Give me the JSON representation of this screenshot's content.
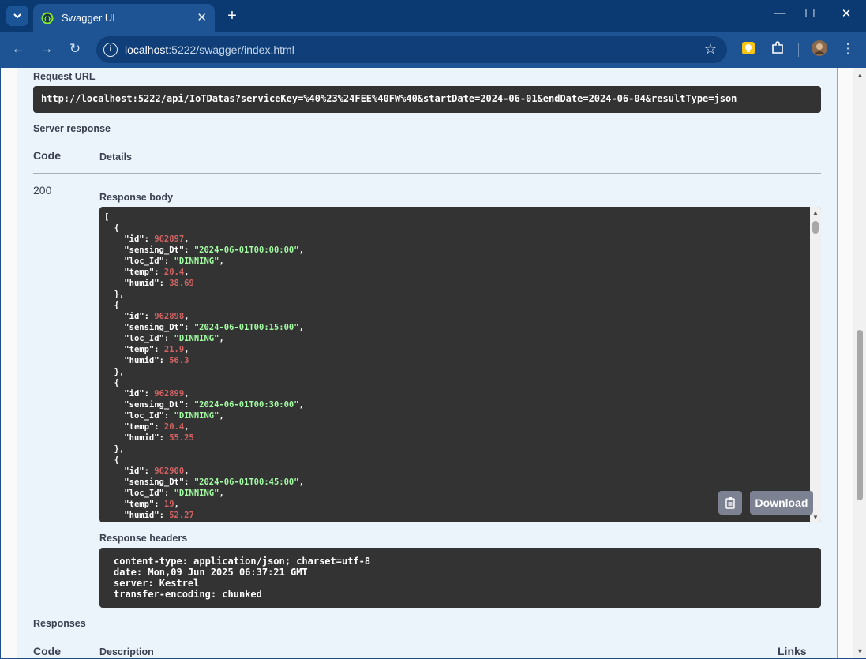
{
  "browser": {
    "tab_title": "Swagger UI",
    "url_host": "localhost",
    "url_path": ":5222/swagger/index.html"
  },
  "swagger": {
    "request_url_label": "Request URL",
    "request_url": "http://localhost:5222/api/IoTDatas?serviceKey=%40%23%24FEE%40FW%40&startDate=2024-06-01&endDate=2024-06-04&resultType=json",
    "server_response_label": "Server response",
    "code_header": "Code",
    "details_header": "Details",
    "status_code": "200",
    "response_body_label": "Response body",
    "response_headers_label": "Response headers",
    "response_headers": "content-type: application/json; charset=utf-8\ndate: Mon,09 Jun 2025 06:37:21 GMT\nserver: Kestrel\ntransfer-encoding: chunked",
    "download_label": "Download",
    "responses_label": "Responses",
    "responses_code_header": "Code",
    "responses_description_header": "Description",
    "responses_links_header": "Links"
  },
  "response_items": [
    {
      "id": "962897",
      "sensing_Dt": "\"2024-06-01T00:00:00\"",
      "loc_Id": "\"DINNING\"",
      "temp": "20.4",
      "humid": "38.69"
    },
    {
      "id": "962898",
      "sensing_Dt": "\"2024-06-01T00:15:00\"",
      "loc_Id": "\"DINNING\"",
      "temp": "21.9",
      "humid": "56.3"
    },
    {
      "id": "962899",
      "sensing_Dt": "\"2024-06-01T00:30:00\"",
      "loc_Id": "\"DINNING\"",
      "temp": "20.4",
      "humid": "55.25"
    },
    {
      "id": "962900",
      "sensing_Dt": "\"2024-06-01T00:45:00\"",
      "loc_Id": "\"DINNING\"",
      "temp": "19",
      "humid": "52.27"
    }
  ]
}
